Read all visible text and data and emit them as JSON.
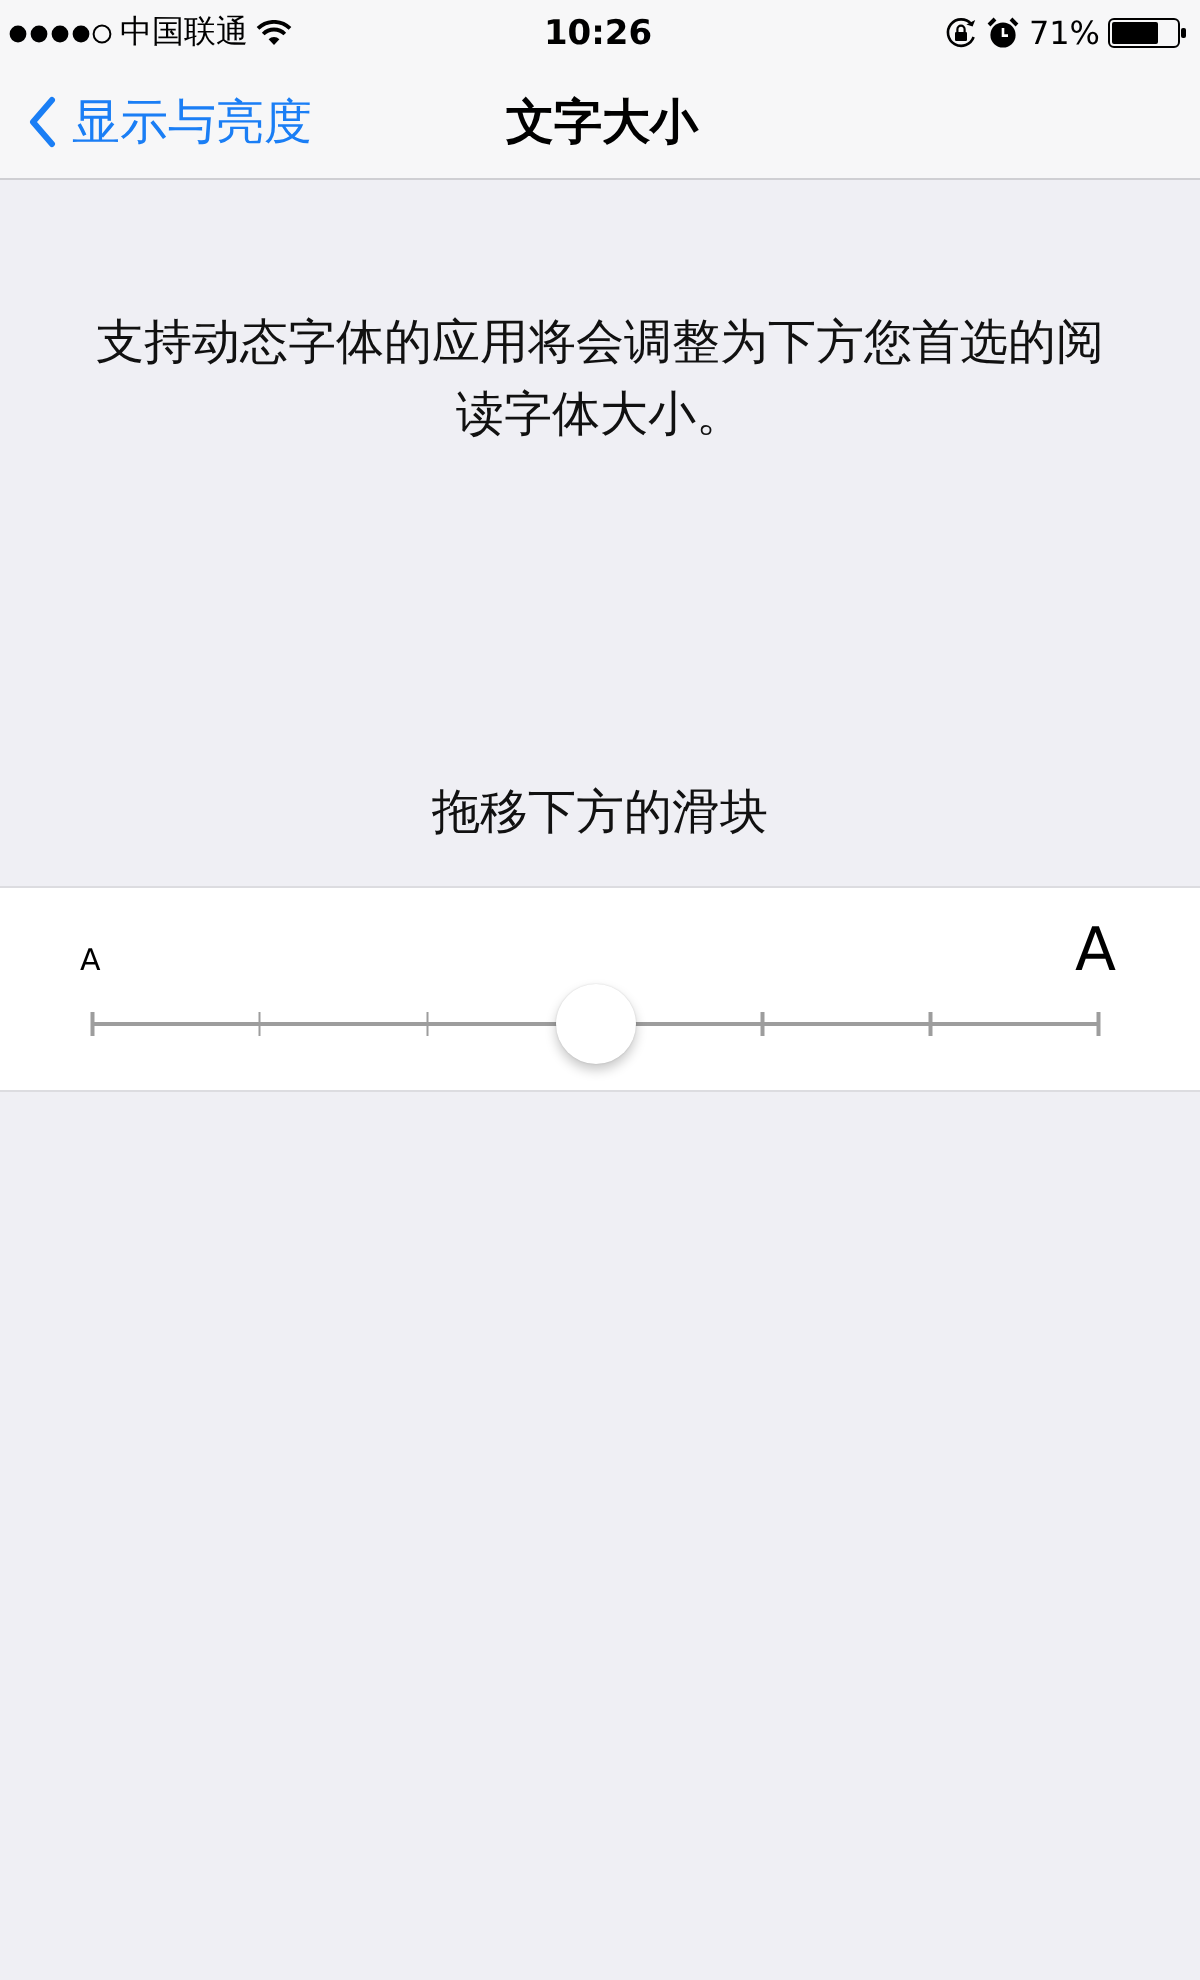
{
  "status_bar": {
    "carrier": "中国联通",
    "time": "10:26",
    "battery": "71%"
  },
  "nav_bar": {
    "back": "显示与亮度",
    "title": "文字大小"
  },
  "description": "支持动态字体的应用将会调整为下方您首选的阅读字体大小。",
  "slider": {
    "hint": "拖移下方的滑块",
    "small_label": "A",
    "large_label": "A",
    "level": 0.5
  }
}
